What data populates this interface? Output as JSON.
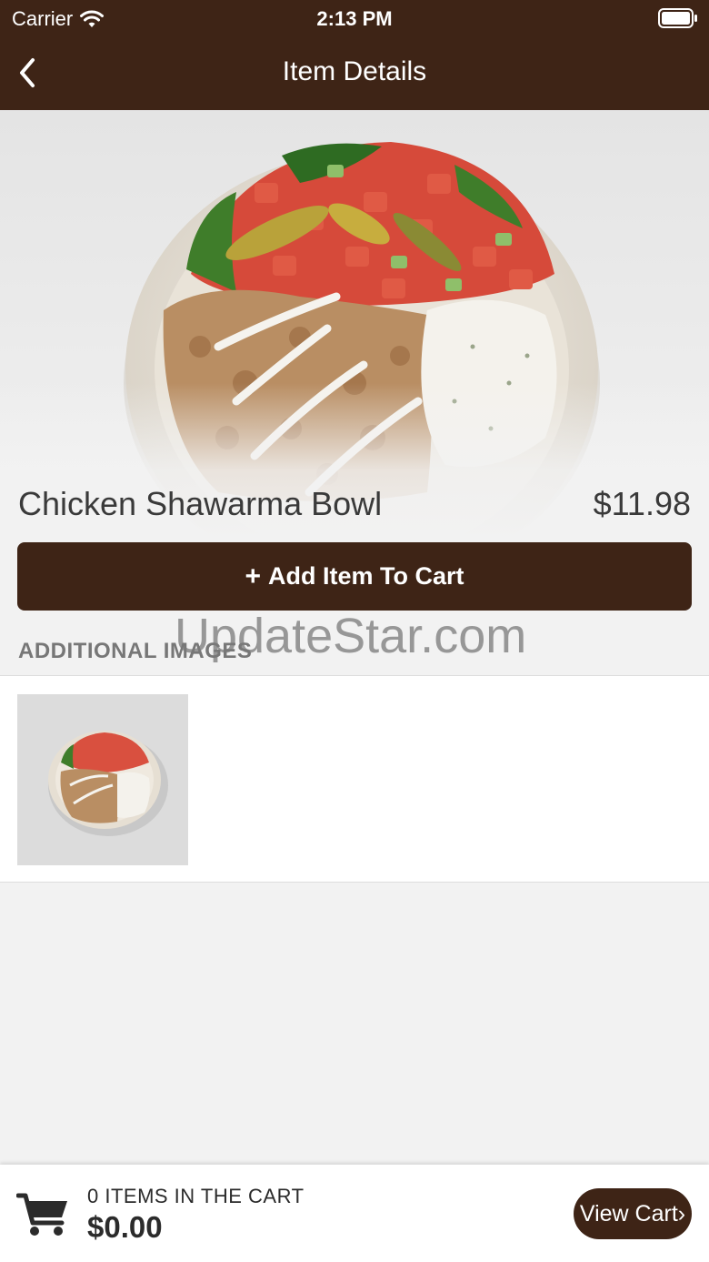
{
  "status_bar": {
    "carrier": "Carrier",
    "time": "2:13 PM",
    "wifi_icon": "wifi-icon",
    "battery_icon": "battery-icon"
  },
  "nav": {
    "title": "Item Details",
    "back_icon": "chevron-left-icon"
  },
  "item": {
    "name": "Chicken Shawarma Bowl",
    "price": "$11.98",
    "image_description": "shawarma-bowl-photo"
  },
  "actions": {
    "add_plus": "+",
    "add_label": "Add Item To Cart"
  },
  "additional_images": {
    "header": "ADDITIONAL IMAGES",
    "count": 1
  },
  "watermark": "UpdateStar.com",
  "cart": {
    "count_label": "0 ITEMS IN THE CART",
    "total": "$0.00",
    "view_label": "View Cart",
    "view_chevron": "›",
    "cart_icon": "shopping-cart-icon"
  },
  "colors": {
    "brand_brown": "#3e2416",
    "background": "#f2f2f2"
  }
}
